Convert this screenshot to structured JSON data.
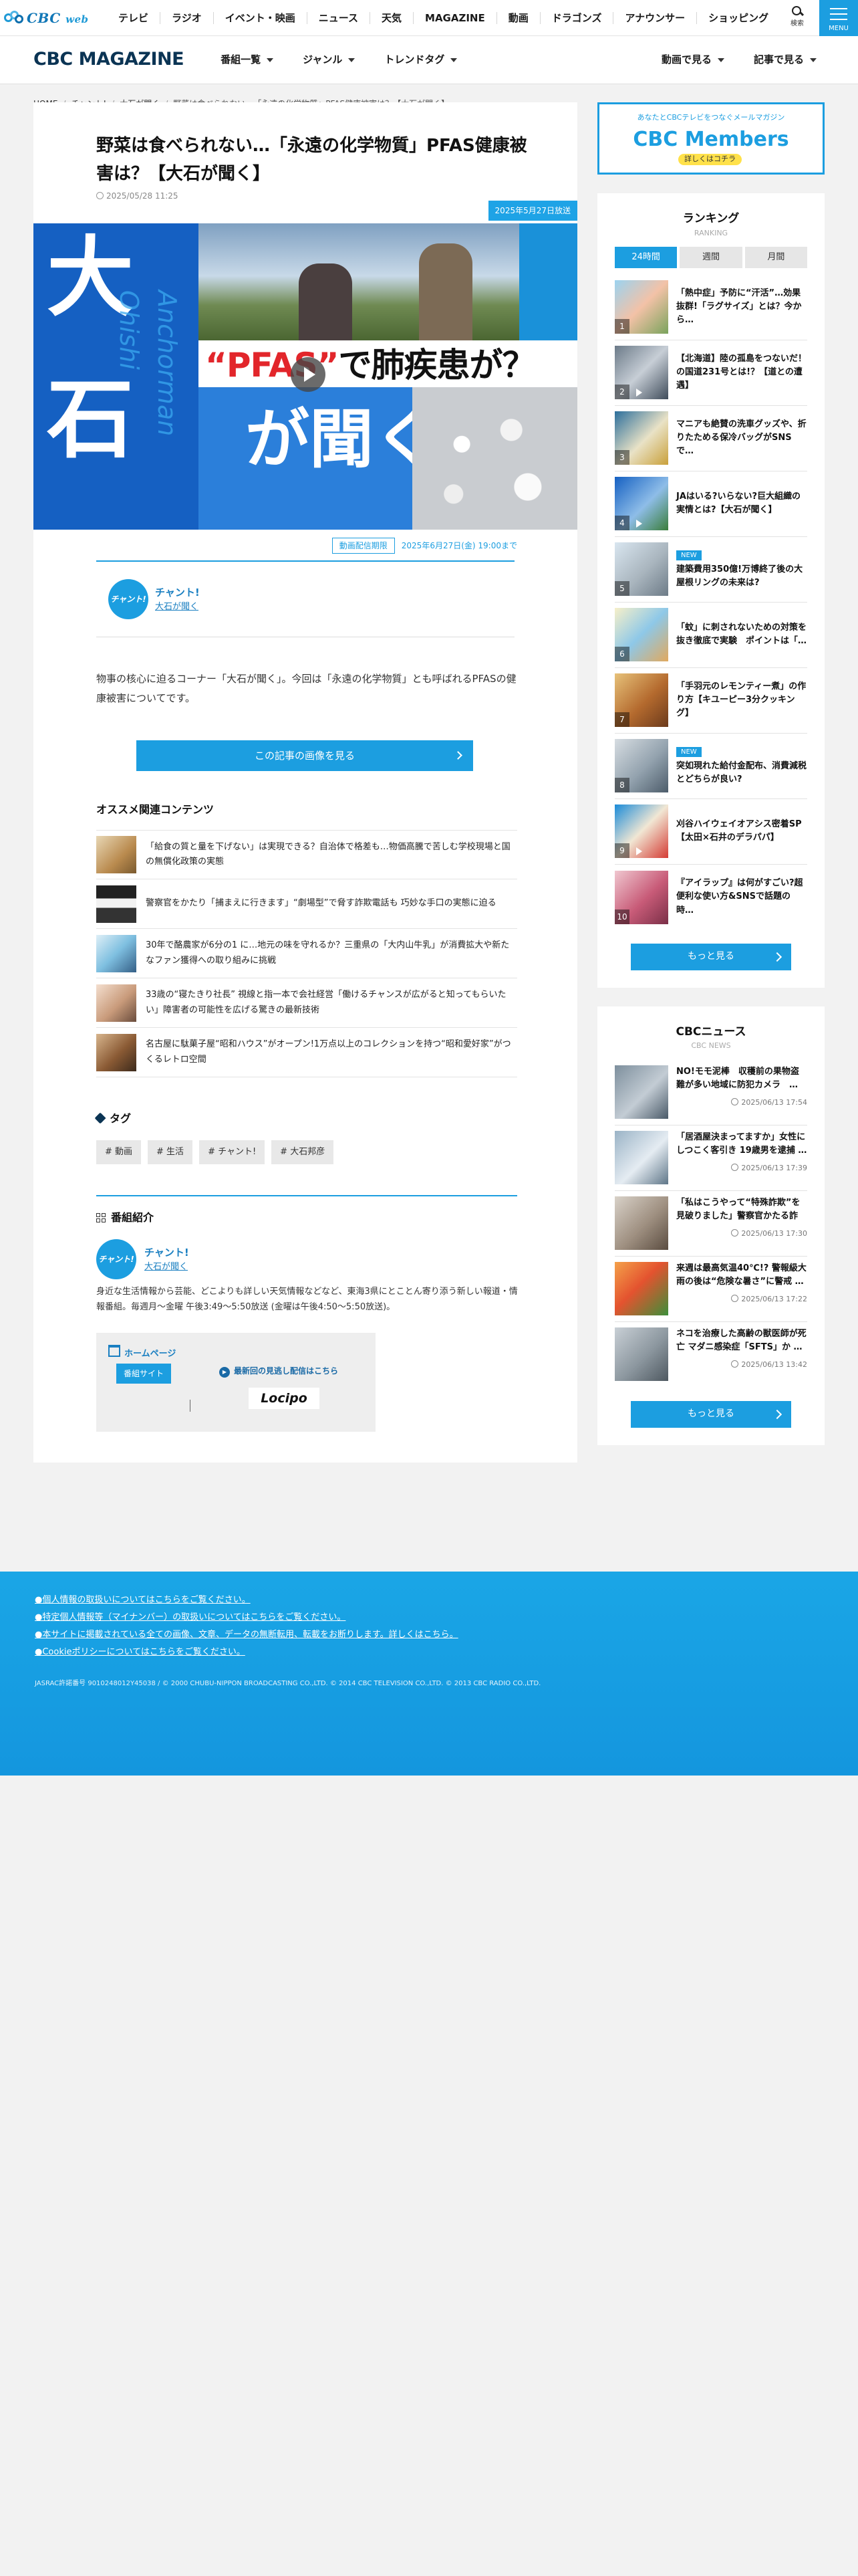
{
  "gnav": {
    "logo_main": "CBC",
    "logo_web": "web",
    "items": [
      "テレビ",
      "ラジオ",
      "イベント・映画",
      "ニュース",
      "天気",
      "MAGAZINE",
      "動画",
      "ドラゴンズ",
      "アナウンサー",
      "ショッピング"
    ],
    "search_label": "検索",
    "menu_label": "MENU"
  },
  "maghead": {
    "title": "CBC MAGAZINE",
    "left": [
      "番組一覧",
      "ジャンル",
      "トレンドタグ"
    ],
    "right": [
      "動画で見る",
      "記事で見る"
    ]
  },
  "breadcrumb": [
    "HOME",
    "チャント!",
    "大石が聞く",
    "野菜は食べられない…「永遠の化学物質」PFAS健康被害は？【大石が聞く】"
  ],
  "article": {
    "title": "野菜は食べられない…「永遠の化学物質」PFAS健康被害は？【大石が聞く】",
    "date": "2025/05/28 11:25",
    "broadcast": "2025年5月27日放送",
    "hero": {
      "kanji1": "大",
      "kanji2": "石",
      "kanji3": "が聞く",
      "vertical": "Anchorman Ohishi",
      "headline_red": "“PFAS”",
      "headline_black": "で肺疾患が？"
    },
    "video_limit_tag": "動画配信期限",
    "video_limit_date": "2025年6月27日(金) 19:00まで",
    "program_badge": "チャント!",
    "program_name": "チャント!",
    "program_sub": "大石が聞く",
    "lead": "物事の核心に迫るコーナー「大石が聞く」。今回は「永遠の化学物質」とも呼ばれるPFASの健康被害についてです。",
    "images_button": "この記事の画像を見る",
    "related_heading": "オススメ関連コンテンツ",
    "related": [
      {
        "text": "「給食の質と量を下げない」は実現できる？自治体で格差も…物価高騰で苦しむ学校現場と国の無償化政策の実態"
      },
      {
        "text": "警察官をかたり「捕まえに行きます」“劇場型”で脅す詐欺電話も 巧妙な手口の実態に迫る"
      },
      {
        "text": "30年で酪農家が6分の1 に…地元の味を守れるか？三重県の「大内山牛乳」が消費拡大や新たなファン獲得への取り組みに挑戦"
      },
      {
        "text": "33歳の“寝たきり社長” 視線と指一本で会社経営「働けるチャンスが広がると知ってもらいたい」障害者の可能性を広げる驚きの最新技術"
      },
      {
        "text": "名古屋に駄菓子屋“昭和ハウス”がオープン!1万点以上のコレクションを持つ“昭和愛好家”がつくるレトロ空間"
      }
    ],
    "tags_heading": "タグ",
    "tags": [
      "# 動画",
      "# 生活",
      "# チャント!",
      "# 大石邦彦"
    ],
    "program_heading": "番組紹介",
    "program2_badge": "チャント!",
    "program2_name": "チャント!",
    "program2_sub": "大石が聞く",
    "program_desc": "身近な生活情報から芸能、どこよりも詳しい天気情報などなど、東海3県にとことん寄り添う新しい報道・情報番組。毎週月～金曜 午後3:49～5:50放送 (金曜は午後4:50～5:50放送)。",
    "hp_label": "ホームページ",
    "hp_site": "番組サイト",
    "hp_missed": "最新回の見逃し配信はこちら",
    "hp_locipo": "Locipo"
  },
  "sidebar": {
    "members_small": "あなたとCBCテレビをつなぐメールマガジン",
    "members_title": "CBC Members",
    "members_cta": "詳しくはコチラ",
    "ranking_title": "ランキング",
    "ranking_en": "RANKING",
    "ranking_tabs": [
      "24時間",
      "週間",
      "月間"
    ],
    "ranking": [
      {
        "n": "1",
        "new": "",
        "text": "「熱中症」予防に“汗活”…効果抜群!「ラグサイズ」とは？今から…"
      },
      {
        "n": "2",
        "new": "",
        "text": "【北海道】陸の孤島をつないだ！の国道231号とは!？【道との遭遇】"
      },
      {
        "n": "3",
        "new": "",
        "text": "マニアも絶賛の洗車グッズや、折りたためる保冷バッグがSNSで…"
      },
      {
        "n": "4",
        "new": "",
        "text": "JAはいる?いらない?巨大組織の実情とは?【大石が聞く】"
      },
      {
        "n": "5",
        "new": "NEW",
        "text": "建築費用350億!万博終了後の大屋根リングの未来は?"
      },
      {
        "n": "6",
        "new": "",
        "text": "「蚊」に刺されないための対策を抜き徹底で実験　ポイントは「…"
      },
      {
        "n": "7",
        "new": "",
        "text": "「手羽元のレモンティー煮」の作り方【キユーピー3分クッキング】"
      },
      {
        "n": "8",
        "new": "NEW",
        "text": "突如現れた給付金配布、消費減税とどちらが良い?"
      },
      {
        "n": "9",
        "new": "",
        "text": "刈谷ハイウェイオアシス密着SP【太田×石井のデラパパ】"
      },
      {
        "n": "10",
        "new": "",
        "text": "『アイラップ』は何がすごい?超便利な使い方&SNSで話題の時…"
      }
    ],
    "more_label": "もっと見る",
    "news_title": "CBCニュース",
    "news_en": "CBC NEWS",
    "news": [
      {
        "text": "NO!モモ泥棒　収穫前の果物盗難が多い地域に防犯カメラ　…",
        "date": "2025/06/13 17:54"
      },
      {
        "text": "「居酒屋決まってますか」女性にしつこく客引き 19歳男を逮捕 …",
        "date": "2025/06/13 17:39"
      },
      {
        "text": "「私はこうやって“特殊詐欺”を見破りました」警察官かたる詐欺…",
        "date": "2025/06/13 17:30"
      },
      {
        "text": "来週は最高気温40℃!? 警報級大雨の後は“危険な暑さ”に警戒 …",
        "date": "2025/06/13 17:22"
      },
      {
        "text": "ネコを治療した高齢の獣医師が死亡 マダニ感染症「SFTS」か …",
        "date": "2025/06/13 13:42"
      }
    ],
    "news_more": "もっと見る"
  },
  "footer": {
    "links": [
      "●個人情報の取扱いについてはこちらをご覧ください。",
      "●特定個人情報等（マイナンバー）の取扱いについてはこちらをご覧ください。",
      "●本サイトに掲載されている全ての画像、文章、データの無断転用、転載をお断りします。詳しくはこちら。",
      "●Cookieポリシーについてはこちらをご覧ください。"
    ],
    "copyright": "JASRAC許諾番号 9010248012Y45038 / © 2000 CHUBU-NIPPON BROADCASTING CO.,LTD. © 2014 CBC TELEVISION CO.,LTD. © 2013 CBC RADIO CO.,LTD."
  },
  "colors": {
    "accent": "#1c9ee0",
    "navy": "#0b3454",
    "footer": "#1aa6e6"
  }
}
